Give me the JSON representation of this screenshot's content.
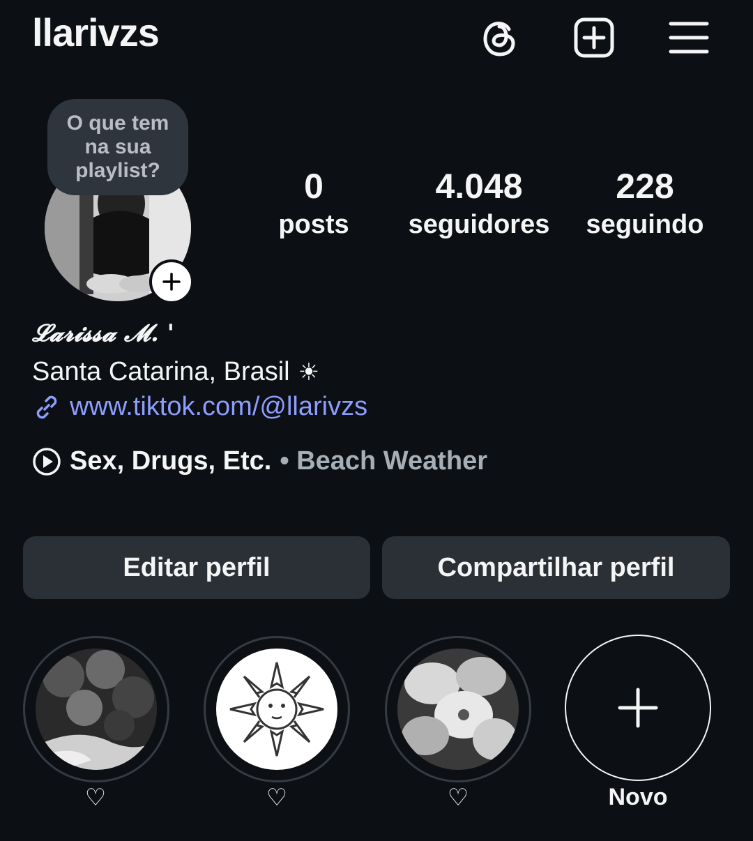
{
  "header": {
    "username": "llarivzs",
    "icons": [
      "threads-icon",
      "create-post-icon",
      "menu-icon"
    ]
  },
  "profile": {
    "note": "O que tem na sua playlist?",
    "stats": [
      {
        "value": "0",
        "label": "posts"
      },
      {
        "value": "4.048",
        "label": "seguidores"
      },
      {
        "value": "228",
        "label": "seguindo"
      }
    ]
  },
  "bio": {
    "display_name": "𝓛𝓪𝓻𝓲𝓼𝓼𝓪 𝓜. '",
    "location": "Santa Catarina, Brasil",
    "location_emoji": "☀",
    "link": "www.tiktok.com/@llarivzs",
    "music_title": "Sex, Drugs, Etc.",
    "music_artist": "• Beach Weather"
  },
  "buttons": {
    "edit": "Editar perfil",
    "share": "Compartilhar perfil"
  },
  "highlights": [
    {
      "label": "♡",
      "image": "tree-photo"
    },
    {
      "label": "♡",
      "image": "sun-drawing"
    },
    {
      "label": "♡",
      "image": "flowers-photo"
    }
  ],
  "new_highlight_label": "Novo",
  "colors": {
    "background": "#0c1014",
    "button": "#2b3036",
    "link": "#8e9dff",
    "note_bubble": "#2f353d"
  }
}
